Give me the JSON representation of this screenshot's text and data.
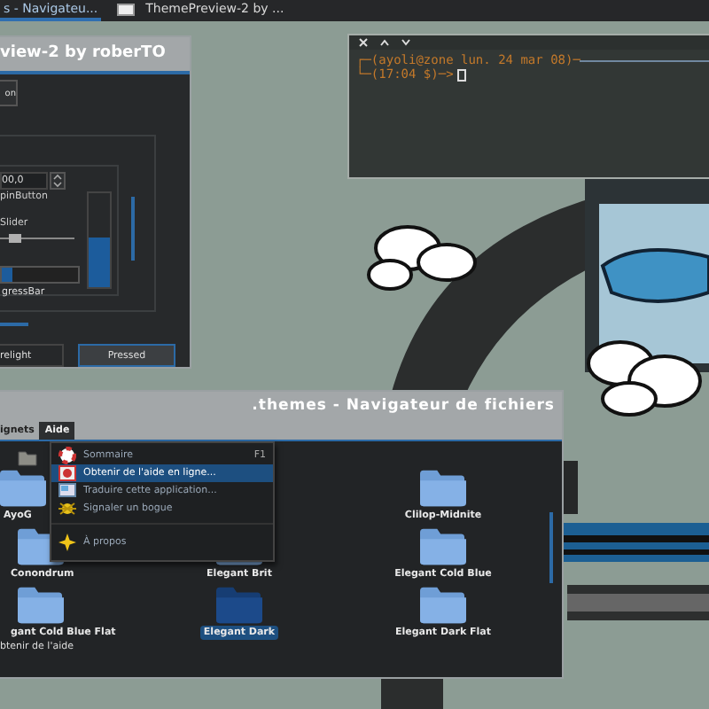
{
  "taskbar": {
    "tasks": [
      {
        "label": "s - Navigateu...",
        "selected": true,
        "icon": false
      },
      {
        "label": "ThemePreview-2 by ...",
        "selected": false,
        "icon": true
      }
    ]
  },
  "preview_window": {
    "title": "view-2 by roberTO",
    "top_button": "on",
    "spin_value": "00,0",
    "spin_label": "pinButton",
    "slider_label": "Slider",
    "slider": {
      "level": 0.12
    },
    "vertical_bar": {
      "level": 0.52
    },
    "progress_label": "gressBar",
    "progress": {
      "level": 0.14
    },
    "buttons": [
      {
        "label": "relight",
        "pressed": false
      },
      {
        "label": "Pressed",
        "pressed": true
      }
    ]
  },
  "terminal": {
    "lines": [
      {
        "text": "┌─(ayoli@zone lun. 24 mar 08)─",
        "rule": true,
        "cursor": false
      },
      {
        "text": "└─(17:04 $)─>",
        "rule": false,
        "cursor": true
      }
    ]
  },
  "file_manager": {
    "title": ".themes - Navigateur de fichiers",
    "menus": [
      {
        "label": "ignets",
        "selected": false
      },
      {
        "label": "Aide",
        "selected": true
      }
    ],
    "help_menu": [
      {
        "kind": "lifebuoy",
        "label": "Sommaire",
        "shortcut": "F1",
        "selected": false,
        "separator_before": false
      },
      {
        "kind": "web",
        "label": "Obtenir de l'aide en ligne...",
        "selected": true,
        "separator_before": false
      },
      {
        "kind": "translate",
        "label": "Traduire cette application...",
        "selected": false,
        "separator_before": false
      },
      {
        "kind": "bug",
        "label": "Signaler un bogue",
        "selected": false,
        "separator_before": false
      },
      {
        "kind": "about",
        "label": "À propos",
        "selected": false,
        "separator_before": true
      }
    ],
    "folders": [
      {
        "label": "AyoG",
        "selected": false
      },
      {
        "label": "Clilop-Midnite",
        "selected": false
      },
      {
        "label": "Conondrum",
        "selected": false
      },
      {
        "label": "Elegant Brit",
        "selected": false
      },
      {
        "label": "Elegant Cold Blue",
        "selected": false
      },
      {
        "label": "gant Cold Blue Flat",
        "selected": false
      },
      {
        "label": "Elegant Dark",
        "selected": true
      },
      {
        "label": "Elegant Dark Flat",
        "selected": false
      }
    ],
    "status": "btenir de l'aide"
  }
}
